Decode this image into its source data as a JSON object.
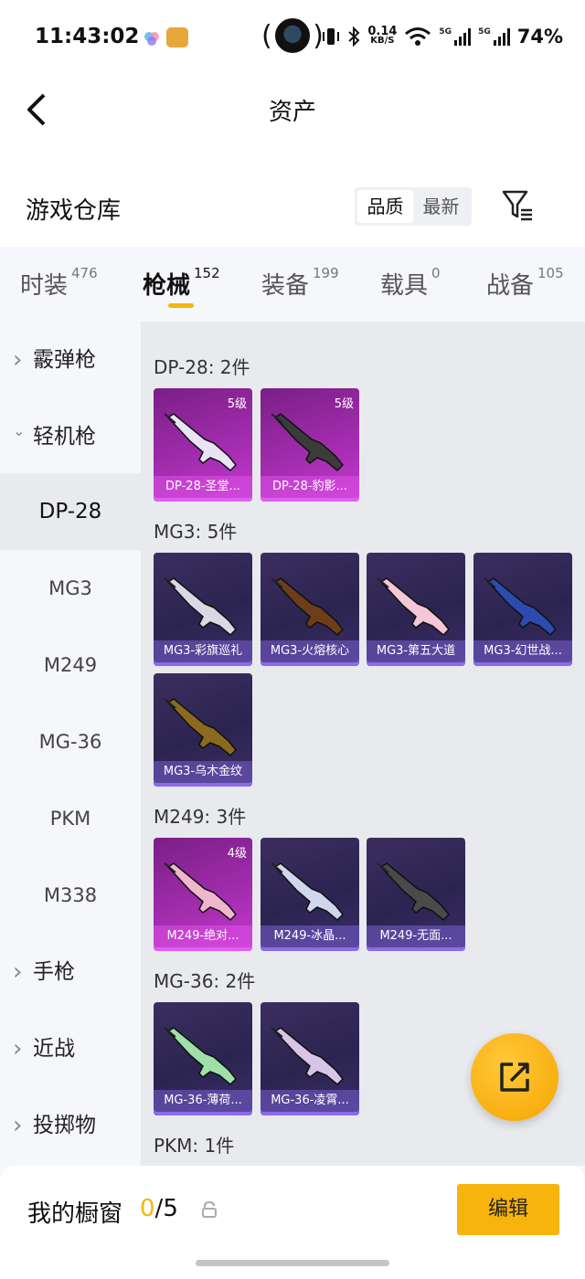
{
  "status": {
    "time": "11:43:02",
    "net_speed_value": "0.14",
    "net_speed_unit": "KB/S",
    "network_1": "5G",
    "network_2": "5G",
    "battery": "74%"
  },
  "header": {
    "title": "资产",
    "back_icon": "back-arrow-icon"
  },
  "warehouse": {
    "title": "游戏仓库",
    "sort_options": [
      "品质",
      "最新"
    ],
    "sort_active": "品质",
    "filter_icon": "filter-icon"
  },
  "tabs": [
    {
      "label": "时装",
      "count": "476"
    },
    {
      "label": "枪械",
      "count": "152",
      "active": true
    },
    {
      "label": "装备",
      "count": "199"
    },
    {
      "label": "载具",
      "count": "0"
    },
    {
      "label": "战备",
      "count": "105"
    }
  ],
  "sidebar": [
    {
      "label": "霰弹枪",
      "type": "parent",
      "expanded": false
    },
    {
      "label": "轻机枪",
      "type": "parent",
      "expanded": true
    },
    {
      "label": "DP-28",
      "type": "child",
      "selected": true
    },
    {
      "label": "MG3",
      "type": "child"
    },
    {
      "label": "M249",
      "type": "child"
    },
    {
      "label": "MG-36",
      "type": "child"
    },
    {
      "label": "PKM",
      "type": "child"
    },
    {
      "label": "M338",
      "type": "child"
    },
    {
      "label": "手枪",
      "type": "parent",
      "expanded": false
    },
    {
      "label": "近战",
      "type": "parent",
      "expanded": false
    },
    {
      "label": "投掷物",
      "type": "parent",
      "expanded": false
    }
  ],
  "groups": [
    {
      "title": "DP-28: 2件",
      "items": [
        {
          "name": "DP-28-圣堂...",
          "level": "5级",
          "rarity": "pink",
          "color": "#e9e3f5"
        },
        {
          "name": "DP-28-豹影...",
          "level": "5级",
          "rarity": "pink",
          "color": "#3b3b3b"
        }
      ]
    },
    {
      "title": "MG3: 5件",
      "items": [
        {
          "name": "MG3-彩旗巡礼",
          "level": "",
          "rarity": "purple",
          "color": "#d9d9e6"
        },
        {
          "name": "MG3-火熔核心",
          "level": "",
          "rarity": "purple",
          "color": "#6e3d1a"
        },
        {
          "name": "MG3-第五大道",
          "level": "",
          "rarity": "purple",
          "color": "#f3c7d6"
        },
        {
          "name": "MG3-幻世战...",
          "level": "",
          "rarity": "purple",
          "color": "#2b4bb0"
        },
        {
          "name": "MG3-乌木金纹",
          "level": "",
          "rarity": "purple",
          "color": "#8a6a1e"
        }
      ]
    },
    {
      "title": "M249: 3件",
      "items": [
        {
          "name": "M249-绝对...",
          "level": "4级",
          "rarity": "pink",
          "color": "#f0b7cc"
        },
        {
          "name": "M249-冰晶...",
          "level": "",
          "rarity": "purple",
          "color": "#cfd6ee"
        },
        {
          "name": "M249-无面...",
          "level": "",
          "rarity": "purple",
          "color": "#4a4a4a"
        }
      ]
    },
    {
      "title": "MG-36: 2件",
      "items": [
        {
          "name": "MG-36-薄荷...",
          "level": "",
          "rarity": "purple",
          "color": "#9fe0a8"
        },
        {
          "name": "MG-36-凌霄...",
          "level": "",
          "rarity": "purple",
          "color": "#d8c4e6"
        }
      ]
    },
    {
      "title": "PKM: 1件",
      "items": []
    }
  ],
  "share_icon": "share-icon",
  "bottom": {
    "showcase_label": "我的橱窗",
    "showcase_current": "0",
    "showcase_sep": "/",
    "showcase_total": "5",
    "lock_icon": "lock-icon",
    "edit_label": "编辑"
  }
}
